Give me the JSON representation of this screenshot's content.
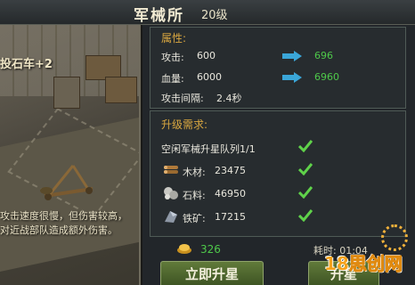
{
  "header": {
    "title": "军械所",
    "level": "20级"
  },
  "scene": {
    "name": "投石车+2",
    "description": "攻击速度很慢，但伤害较高，对近战部队造成额外伤害。"
  },
  "attributes": {
    "label": "属性:",
    "attack": {
      "label": "攻击:",
      "current": "600",
      "next": "696"
    },
    "hp": {
      "label": "血量:",
      "current": "6000",
      "next": "6960"
    },
    "interval": {
      "label": "攻击间隔:",
      "value": "2.4秒"
    }
  },
  "requirements": {
    "label": "升级需求:",
    "idle_queue": "空闲军械升星队列1/1",
    "wood": {
      "label": "木材:",
      "value": "23475"
    },
    "stone": {
      "label": "石料:",
      "value": "46950"
    },
    "iron": {
      "label": "铁矿:",
      "value": "17215"
    }
  },
  "cost": {
    "gold": "326",
    "time": "耗时: 01:04"
  },
  "buttons": {
    "upgrade_now": "立即升星",
    "upgrade": "升星"
  },
  "watermark": {
    "text": "18",
    "suffix": "思创网"
  },
  "colors": {
    "accent": "#d9a740",
    "positive": "#4ec84a",
    "arrow": "#3aa6d8"
  },
  "icons": [
    "right-arrow-icon",
    "check-icon",
    "wood-icon",
    "stone-icon",
    "iron-icon",
    "gold-icon"
  ]
}
